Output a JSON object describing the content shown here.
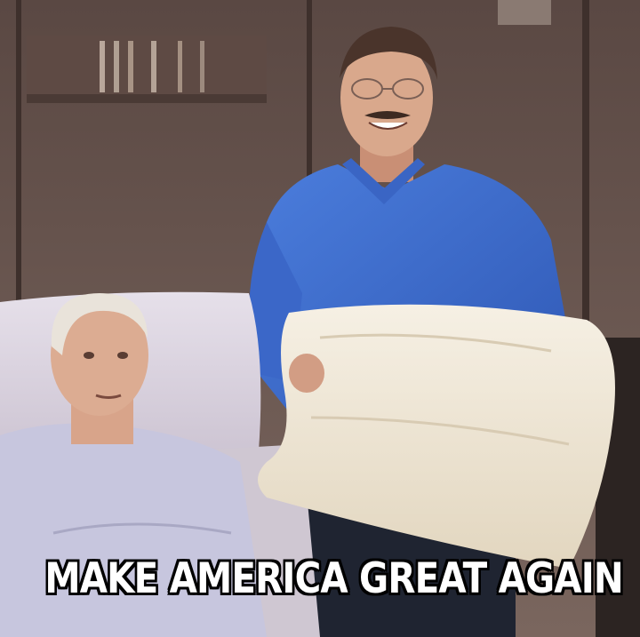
{
  "meme": {
    "caption": "MAKE AMERICA GREAT AGAIN"
  },
  "colors": {
    "wall": "#6e5a52",
    "shirt": "#3f6fd0",
    "pillow": "#efe7d6",
    "bed": "#d9d2dc",
    "skin": "#d9a88c"
  }
}
